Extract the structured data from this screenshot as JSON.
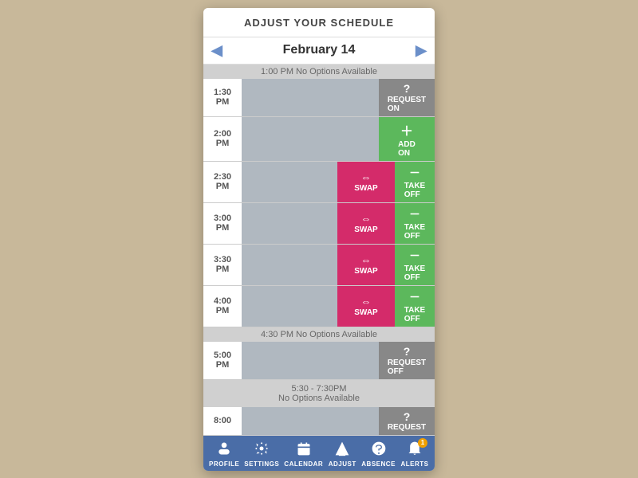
{
  "app": {
    "title": "ADJUST YOUR SCHEDULE"
  },
  "dateNav": {
    "label": "February 14",
    "prevArrow": "◀",
    "nextArrow": "▶"
  },
  "noOptions1": "1:00 PM  No Options Available",
  "rows": [
    {
      "time": "1:00\nPM",
      "type": "no-options"
    },
    {
      "time": "2:00\nPM",
      "type": "add-on",
      "addLabel": "ADD\nON"
    },
    {
      "time": "2:30\nPM",
      "type": "swap-takeoff",
      "swapLabel": "SWAP",
      "takeLabel": "TAKE\nOFF"
    },
    {
      "time": "3:00\nPM",
      "type": "swap-takeoff",
      "swapLabel": "SWAP",
      "takeLabel": "TAKE\nOFF"
    },
    {
      "time": "3:30\nPM",
      "type": "swap-takeoff",
      "swapLabel": "SWAP",
      "takeLabel": "TAKE\nOFF"
    },
    {
      "time": "4:00\nPM",
      "type": "swap-takeoff",
      "swapLabel": "SWAP",
      "takeLabel": "TAKE\nOFF"
    }
  ],
  "noOptions2": "4:30 PM  No Options Available",
  "requestOffRow": {
    "time": "5:00\nPM",
    "label": "REQUEST\nOFF"
  },
  "noOptions3Line1": "5:30 - 7:30PM",
  "noOptions3Line2": "No Options Available",
  "partialRow": {
    "time": "8:00",
    "label": "REQUEST"
  },
  "nav": [
    {
      "id": "profile",
      "icon": "👤",
      "label": "PROFILE"
    },
    {
      "id": "settings",
      "icon": "⚙",
      "label": "SETTINGS"
    },
    {
      "id": "calendar",
      "icon": "📅",
      "label": "CALENDAR"
    },
    {
      "id": "adjust",
      "icon": "✂",
      "label": "ADJUST"
    },
    {
      "id": "absence",
      "icon": "💬",
      "label": "ABSENCE"
    },
    {
      "id": "alerts",
      "icon": "🔔",
      "label": "ALERTS",
      "badge": "1"
    }
  ]
}
